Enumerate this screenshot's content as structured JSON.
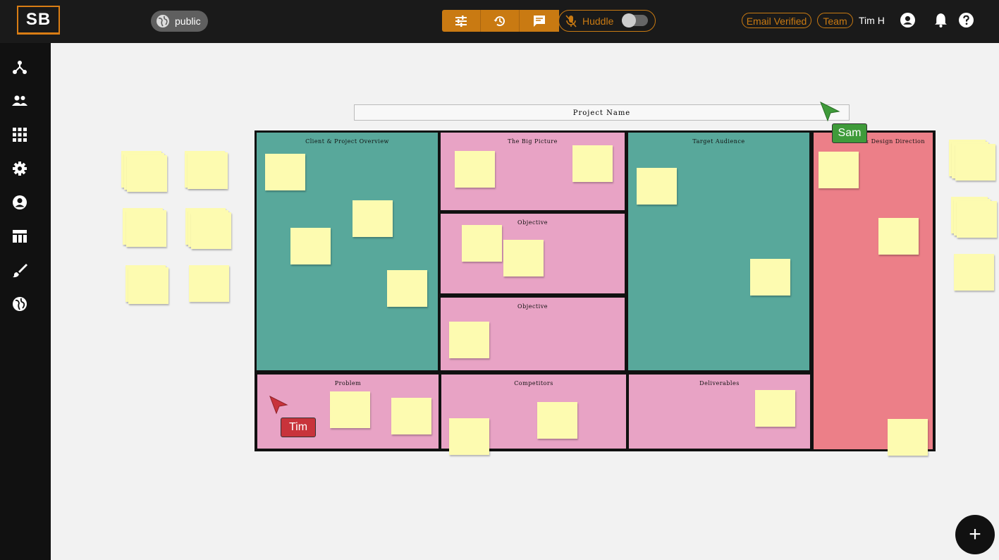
{
  "header": {
    "logo_text": "SB",
    "visibility_label": "public",
    "huddle_label": "Huddle",
    "huddle_on": false,
    "email_badge": "Email Verified",
    "team_badge": "Team",
    "user_name": "Tim H"
  },
  "board": {
    "project_name": "Project  Name",
    "sections": {
      "client_overview": "Client & Project Overview",
      "big_picture": "The Big Picture",
      "objective_1": "Objective",
      "objective_2": "Objective",
      "target_audience": "Target Audience",
      "design_direction": "& Design Direction",
      "problem": "Problem",
      "competitors": "Competitors",
      "deliverables": "Deliverables"
    },
    "cursors": [
      {
        "name": "Sam",
        "color": "#3f9b3a"
      },
      {
        "name": "Tim",
        "color": "#c8333b"
      }
    ]
  },
  "colors": {
    "accent": "#c97a12",
    "teal": "#58a89b",
    "pink": "#e8a3c5",
    "red": "#ec7f88",
    "sticky": "#fdfbb0"
  },
  "fab_label": "+"
}
